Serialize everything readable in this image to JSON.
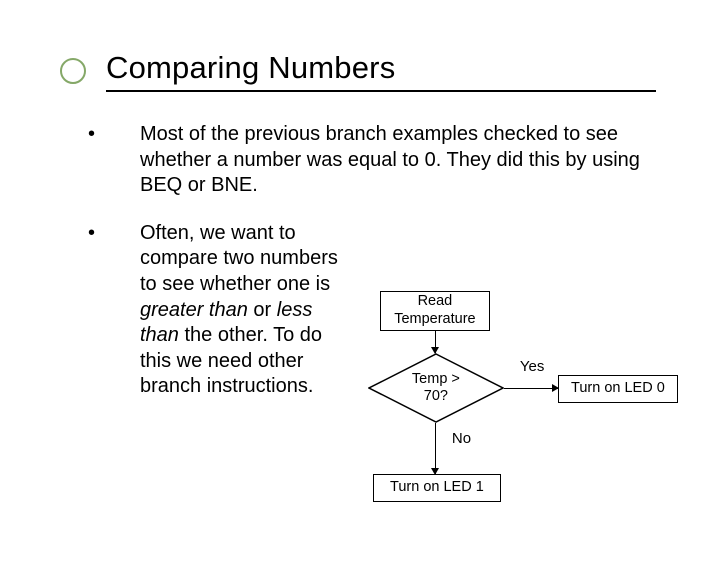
{
  "title": "Comparing Numbers",
  "bullets": {
    "b1": "Most of the previous branch examples checked to see whether a number was equal to 0.  They did this by using BEQ or BNE.",
    "b2_pre": "Often, we want to compare two numbers to see whether one is ",
    "b2_gt": "greater than",
    "b2_mid": " or ",
    "b2_lt": "less than",
    "b2_post": " the other.  To do this we need other branch instructions."
  },
  "flow": {
    "read_l1": "Read",
    "read_l2": "Temperature",
    "decision_l1": "Temp >",
    "decision_l2": "70?",
    "yes": "Yes",
    "no": "No",
    "led0": "Turn on LED 0",
    "led1": "Turn on LED 1"
  }
}
